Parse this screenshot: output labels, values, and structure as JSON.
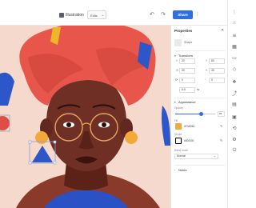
{
  "app": {
    "file_name": "Illustration",
    "file_tag": "Edits",
    "share_label": "Share",
    "undo_icon": "undo-icon",
    "redo_icon": "redo-icon"
  },
  "colors": {
    "accent": "#2f6fe0",
    "canvas_bg": "#f5d9cc",
    "skin": "#6f2f25",
    "turban": "#e8564b",
    "turban_blue": "#2d56c8",
    "turban_yellow": "#f0b62a",
    "earring": "#f3a93a",
    "shirt_blue": "#2a52c6",
    "fill_swatch": "#F3A93A",
    "stroke_swatch": "#000000"
  },
  "panel": {
    "title": "Properties",
    "shape_label": "Shape",
    "transform_head": "Transform",
    "x_label": "X",
    "x_value": "20",
    "y_label": "Y",
    "y_value": "80",
    "w_label": "W",
    "w_value": "30",
    "h_label": "H",
    "h_value": "30",
    "rot_label": "Rotation",
    "rot_value": "0",
    "r_label": "Radius",
    "r_value": "0",
    "scale_value": "6.5",
    "appearance_head": "Appearance",
    "opacity_label": "Opacity",
    "opacity_value": "65",
    "opacity_fraction": 0.65,
    "fill_label": "Fill",
    "fill_value": "#F3A93A",
    "stroke_label": "Stroke",
    "stroke_value": "#000000",
    "blend_label": "Blend mode",
    "blend_value": "Normal",
    "notes_head": "Notes"
  }
}
